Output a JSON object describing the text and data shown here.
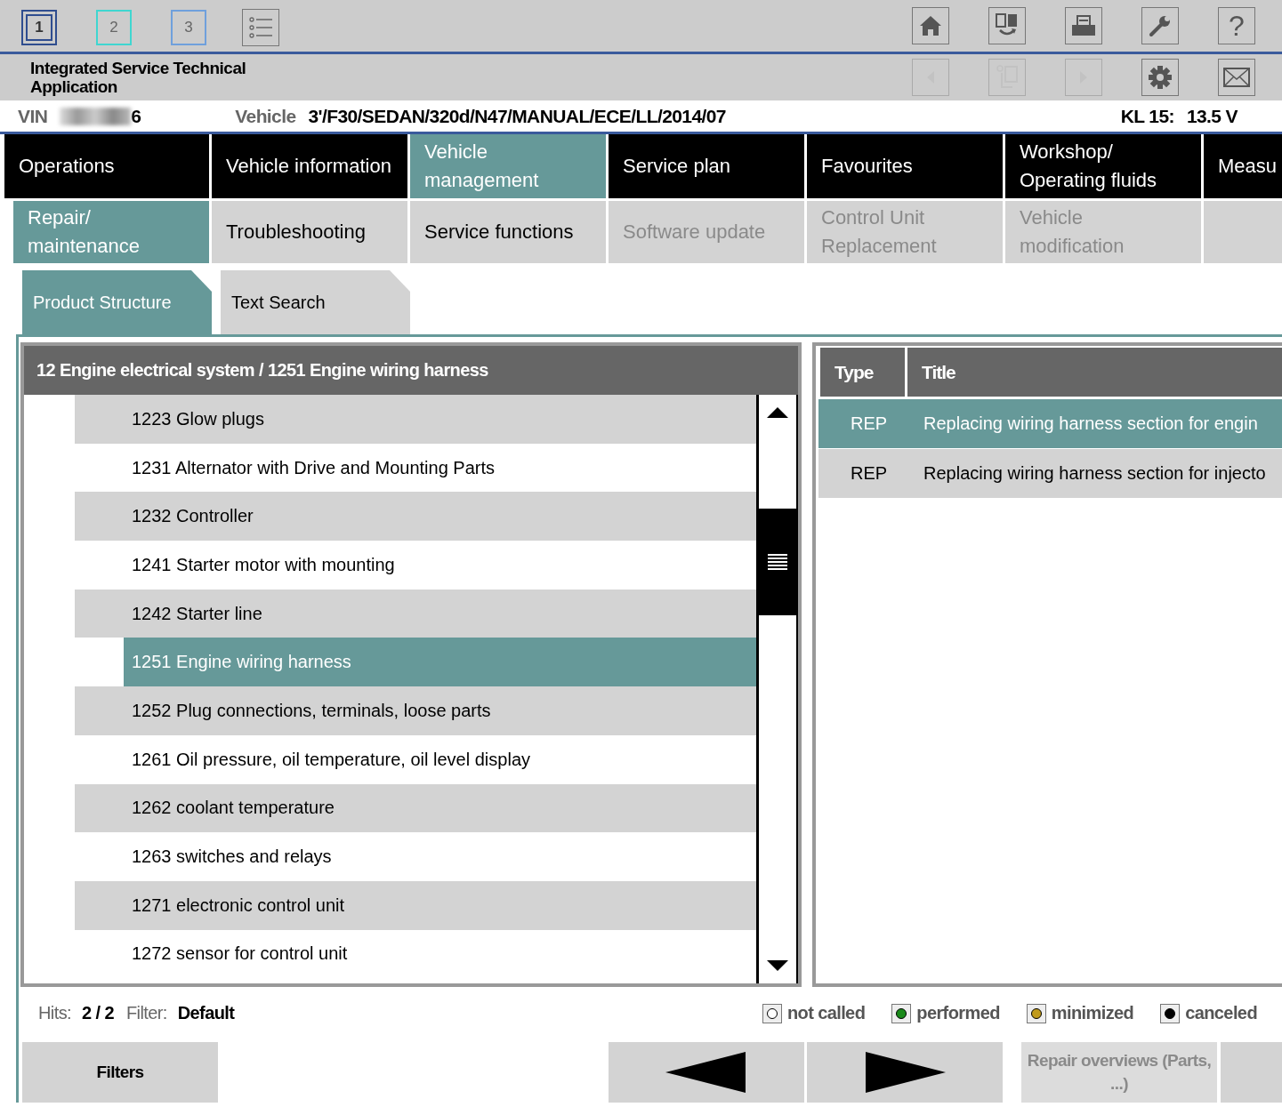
{
  "workspaces": [
    {
      "label": "1",
      "selected": true,
      "color": "#2f4d8f"
    },
    {
      "label": "2",
      "selected": false,
      "color": "#3fd6d0"
    },
    {
      "label": "3",
      "selected": false,
      "color": "#6fa0dc"
    }
  ],
  "app_title": "Integrated Service Technical Application",
  "toolbar_top": [
    {
      "kind": "home",
      "disabled": false
    },
    {
      "kind": "swap",
      "disabled": false
    },
    {
      "kind": "print",
      "disabled": false
    },
    {
      "kind": "wrench",
      "disabled": false
    },
    {
      "kind": "help",
      "disabled": false
    }
  ],
  "toolbar_bottom": [
    {
      "kind": "back",
      "disabled": true
    },
    {
      "kind": "copy",
      "disabled": true
    },
    {
      "kind": "forward",
      "disabled": true
    },
    {
      "kind": "gear",
      "disabled": false
    },
    {
      "kind": "mail",
      "disabled": false
    }
  ],
  "help_label": "?",
  "vehicle_bar": {
    "vin_label": "VIN",
    "vin_tail": "6",
    "vehicle_label": "Vehicle",
    "vehicle_value": "3'/F30/SEDAN/320d/N47/MANUAL/ECE/LL/2014/07",
    "kl_label": "KL 15:",
    "kl_value": "13.5 V"
  },
  "main_nav": [
    {
      "label": "Operations",
      "selected": false
    },
    {
      "label": "Vehicle information",
      "selected": false
    },
    {
      "label": "Vehicle management",
      "selected": true
    },
    {
      "label": "Service plan",
      "selected": false
    },
    {
      "label": "Favourites",
      "selected": false
    },
    {
      "label": "Workshop/ Operating fluids",
      "selected": false
    },
    {
      "label": "Measu",
      "selected": false
    }
  ],
  "sub_nav": [
    {
      "label": "Repair/ maintenance",
      "selected": true,
      "disabled": false
    },
    {
      "label": "Troubleshooting",
      "selected": false,
      "disabled": false
    },
    {
      "label": "Service functions",
      "selected": false,
      "disabled": false
    },
    {
      "label": "Software update",
      "selected": false,
      "disabled": true
    },
    {
      "label": "Control Unit Replacement",
      "selected": false,
      "disabled": true
    },
    {
      "label": "Vehicle modification",
      "selected": false,
      "disabled": true
    }
  ],
  "view_tabs": [
    {
      "label": "Product Structure",
      "selected": true
    },
    {
      "label": "Text Search",
      "selected": false
    }
  ],
  "tree": {
    "breadcrumb": "12 Engine electrical system / 1251 Engine wiring harness",
    "items": [
      {
        "label": "1223 Glow plugs",
        "selected": false
      },
      {
        "label": "1231 Alternator with Drive and Mounting Parts",
        "selected": false
      },
      {
        "label": "1232 Controller",
        "selected": false
      },
      {
        "label": "1241 Starter motor with mounting",
        "selected": false
      },
      {
        "label": "1242 Starter line",
        "selected": false
      },
      {
        "label": "1251 Engine wiring harness",
        "selected": true
      },
      {
        "label": "1252 Plug connections, terminals, loose parts",
        "selected": false
      },
      {
        "label": "1261 Oil pressure, oil temperature, oil level display",
        "selected": false
      },
      {
        "label": "1262 coolant temperature",
        "selected": false
      },
      {
        "label": "1263 switches and relays",
        "selected": false
      },
      {
        "label": "1271 electronic control unit",
        "selected": false
      },
      {
        "label": "1272 sensor for control unit",
        "selected": false
      }
    ]
  },
  "results": {
    "columns": [
      "Type",
      "Title"
    ],
    "rows": [
      {
        "type": "REP",
        "title": "Replacing wiring harness section for engin",
        "selected": true
      },
      {
        "type": "REP",
        "title": "Replacing wiring harness section for injecto",
        "selected": false
      }
    ]
  },
  "status": {
    "hits_label": "Hits:",
    "hits_value": "2 / 2",
    "filter_label": "Filter:",
    "filter_value": "Default"
  },
  "legend": [
    {
      "label": "not called",
      "color": "#ffffff"
    },
    {
      "label": "performed",
      "color": "#1a8a1a"
    },
    {
      "label": "minimized",
      "color": "#c09a1a"
    },
    {
      "label": "canceled",
      "color": "#000000"
    }
  ],
  "buttons": [
    {
      "kind": "text",
      "label": "Filters",
      "disabled": false
    },
    {
      "kind": "prev",
      "disabled": false
    },
    {
      "kind": "next",
      "disabled": false
    },
    {
      "kind": "text",
      "label": "Repair overviews (Parts, ...)",
      "disabled": true
    },
    {
      "kind": "blank",
      "disabled": false
    }
  ]
}
